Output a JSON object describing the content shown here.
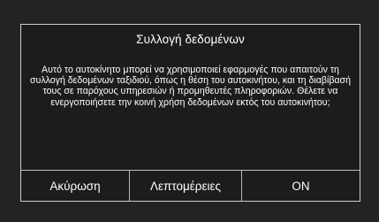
{
  "dialog": {
    "title": "Συλλογή δεδομένων",
    "message": "Αυτό το αυτοκίνητο μπορεί να χρησιμοποιεί εφαρμογές που απαιτούν τη συλλογή δεδομένων ταξιδιού, όπως η θέση του αυτοκινήτου, και τη διαβίβασή τους σε παρόχους υπηρεσιών ή προμηθευτές πληροφοριών. Θέλετε να ενεργοποιήσετε την κοινή χρήση δεδομένων εκτός του αυτοκινήτου;",
    "buttons": {
      "cancel": "Ακύρωση",
      "details": "Λεπτομέρειες",
      "on": "ON"
    }
  },
  "colors": {
    "background": "#232323",
    "dialog_background": "#1c1c1c",
    "border": "#cfcfcf",
    "text": "#ffffff"
  }
}
